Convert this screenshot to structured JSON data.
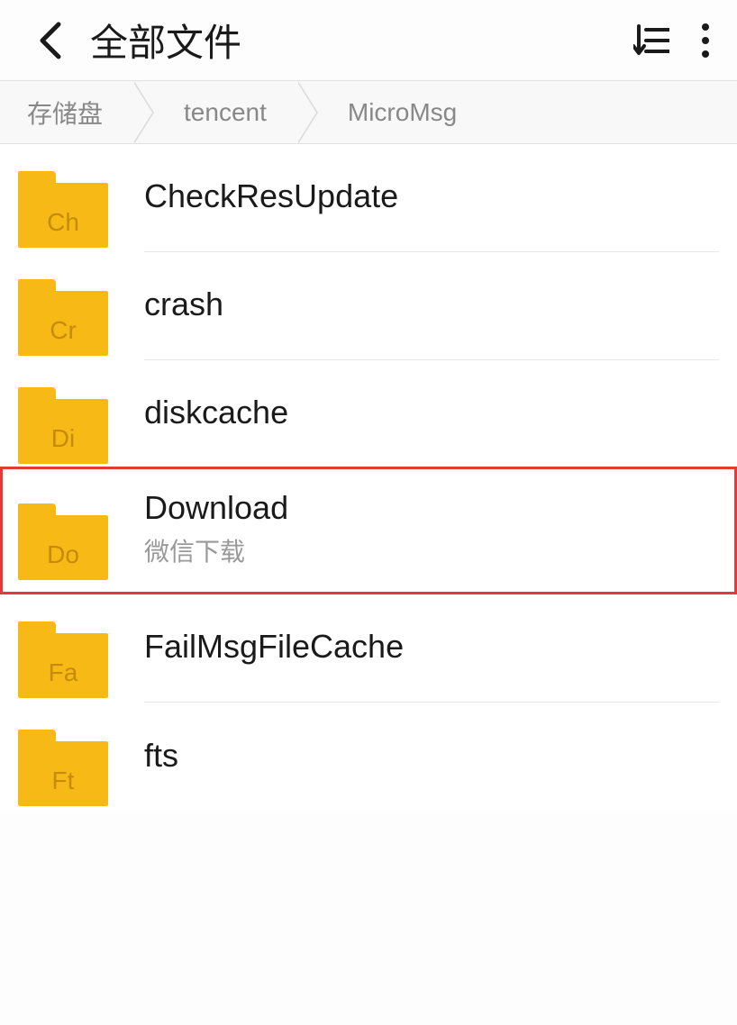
{
  "header": {
    "title": "全部文件"
  },
  "breadcrumb": [
    {
      "label": "存储盘"
    },
    {
      "label": "tencent"
    },
    {
      "label": "MicroMsg"
    }
  ],
  "files": [
    {
      "abbr": "Ch",
      "name": "CheckResUpdate",
      "sub": "",
      "highlighted": false
    },
    {
      "abbr": "Cr",
      "name": "crash",
      "sub": "",
      "highlighted": false
    },
    {
      "abbr": "Di",
      "name": "diskcache",
      "sub": "",
      "highlighted": false
    },
    {
      "abbr": "Do",
      "name": "Download",
      "sub": "微信下载",
      "highlighted": true
    },
    {
      "abbr": "Fa",
      "name": "FailMsgFileCache",
      "sub": "",
      "highlighted": false
    },
    {
      "abbr": "Ft",
      "name": "fts",
      "sub": "",
      "highlighted": false
    }
  ]
}
